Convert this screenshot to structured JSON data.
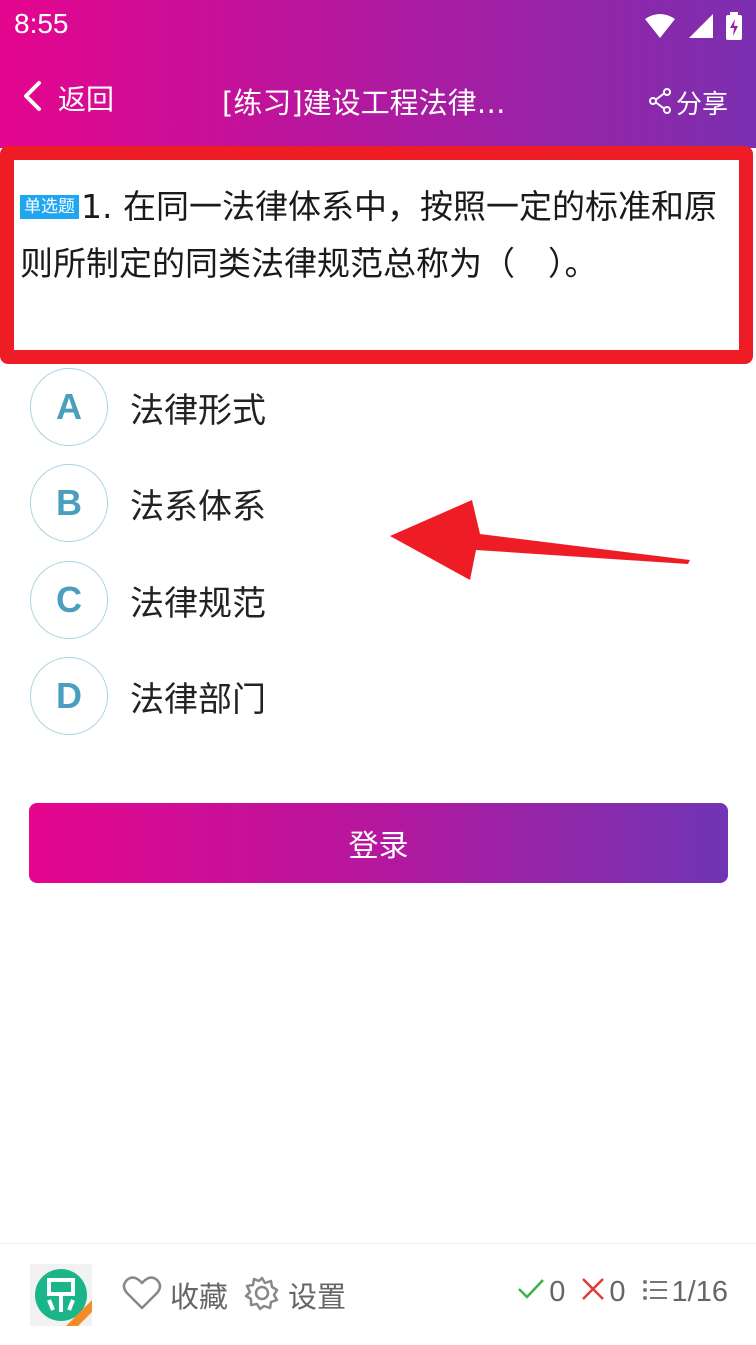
{
  "status_bar": {
    "time": "8:55"
  },
  "nav": {
    "back_label": "返回",
    "title": "[练习]建设工程法律…",
    "share_label": "分享"
  },
  "question": {
    "type_badge": "单选题",
    "text": "1. 在同一法律体系中，按照一定的标准和原则所制定的同类法律规范总称为（　）。"
  },
  "options": [
    {
      "letter": "A",
      "text": "法律形式"
    },
    {
      "letter": "B",
      "text": "法系体系"
    },
    {
      "letter": "C",
      "text": "法律规范"
    },
    {
      "letter": "D",
      "text": "法律部门"
    }
  ],
  "login_button": "登录",
  "bottom_bar": {
    "favorite_label": "收藏",
    "settings_label": "设置",
    "correct_count": "0",
    "wrong_count": "0",
    "progress": "1/16"
  },
  "colors": {
    "accent_start": "#e5058e",
    "accent_end": "#6f35b4",
    "highlight_red": "#ee1c24",
    "badge_blue": "#1fa6f0",
    "correct_green": "#3cb34a",
    "wrong_red": "#e03a3a"
  }
}
